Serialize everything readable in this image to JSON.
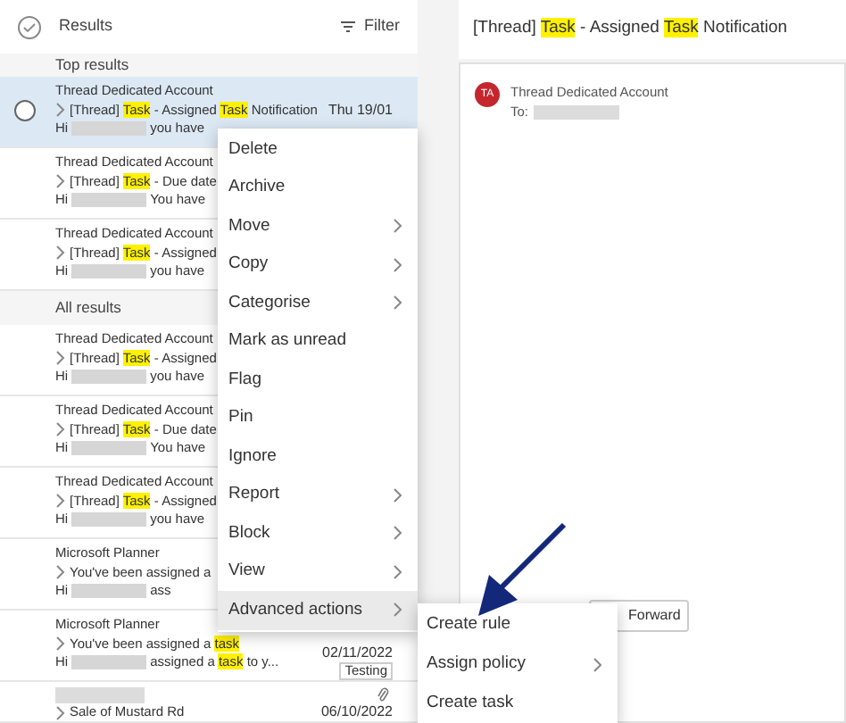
{
  "list_header": {
    "title": "Results",
    "filter": "Filter"
  },
  "sections": [
    {
      "label": "Top results",
      "rows": [
        {
          "sender": "Thread Dedicated Account",
          "subject": [
            {
              "text": "[Thread] ",
              "highlight": false
            },
            {
              "text": "Task",
              "highlight": true
            },
            {
              "text": " - Assigned ",
              "highlight": false
            },
            {
              "text": "Task",
              "highlight": true
            },
            {
              "text": " Notification",
              "highlight": false
            }
          ],
          "greeting": "Hi",
          "preview": [
            {
              "text": "you have",
              "highlight": false
            }
          ],
          "date": "Thu 19/01",
          "selected": true
        },
        {
          "sender": "Thread Dedicated Account",
          "subject": [
            {
              "text": "[Thread] ",
              "highlight": false
            },
            {
              "text": "Task",
              "highlight": true
            },
            {
              "text": " - Due date",
              "highlight": false
            }
          ],
          "greeting": "Hi",
          "preview": [
            {
              "text": "You have",
              "highlight": false
            }
          ],
          "selected": false
        },
        {
          "sender": "Thread Dedicated Account",
          "subject": [
            {
              "text": "[Thread] ",
              "highlight": false
            },
            {
              "text": "Task",
              "highlight": true
            },
            {
              "text": " - Assigned",
              "highlight": false
            }
          ],
          "greeting": "Hi",
          "preview": [
            {
              "text": "you have",
              "highlight": false
            }
          ],
          "selected": false
        }
      ]
    },
    {
      "label": "All results",
      "rows": [
        {
          "sender": "Thread Dedicated Account",
          "subject": [
            {
              "text": "[Thread] ",
              "highlight": false
            },
            {
              "text": "Task",
              "highlight": true
            },
            {
              "text": " - Assigned",
              "highlight": false
            }
          ],
          "greeting": "Hi",
          "preview": [
            {
              "text": "you have",
              "highlight": false
            }
          ],
          "selected": false
        },
        {
          "sender": "Thread Dedicated Account",
          "subject": [
            {
              "text": "[Thread] ",
              "highlight": false
            },
            {
              "text": "Task",
              "highlight": true
            },
            {
              "text": " - Due date",
              "highlight": false
            }
          ],
          "greeting": "Hi",
          "preview": [
            {
              "text": "You have",
              "highlight": false
            }
          ],
          "selected": false
        },
        {
          "sender": "Thread Dedicated Account",
          "subject": [
            {
              "text": "[Thread] ",
              "highlight": false
            },
            {
              "text": "Task",
              "highlight": true
            },
            {
              "text": " - Assigned",
              "highlight": false
            }
          ],
          "greeting": "Hi",
          "preview": [
            {
              "text": "you have",
              "highlight": false
            }
          ],
          "selected": false
        },
        {
          "sender": "Microsoft Planner",
          "subject": [
            {
              "text": "You've been assigned a",
              "highlight": false
            }
          ],
          "greeting": "Hi",
          "preview": [
            {
              "text": "ass",
              "highlight": false
            }
          ],
          "selected": false
        },
        {
          "sender": "Microsoft Planner",
          "subject": [
            {
              "text": "You've been assigned a ",
              "highlight": false
            },
            {
              "text": "task",
              "highlight": true
            }
          ],
          "greeting": "Hi",
          "preview": [
            {
              "text": "assigned a ",
              "highlight": false
            },
            {
              "text": "task",
              "highlight": true
            },
            {
              "text": " to y...",
              "highlight": false
            }
          ],
          "date": "02/11/2022",
          "tag": "Testing",
          "selected": false
        },
        {
          "sender_hidden": true,
          "subject": [
            {
              "text": "Sale of Mustard Rd",
              "highlight": false
            }
          ],
          "date": "06/10/2022",
          "attachment": true,
          "selected": false
        }
      ]
    }
  ],
  "reading_pane": {
    "title": [
      {
        "text": "[Thread] ",
        "highlight": false
      },
      {
        "text": "Task",
        "highlight": true
      },
      {
        "text": " - Assigned ",
        "highlight": false
      },
      {
        "text": "Task",
        "highlight": true
      },
      {
        "text": " Notification",
        "highlight": false
      }
    ],
    "avatar": "TA",
    "sender": "Thread Dedicated Account",
    "to_label": "To:",
    "buttons": [
      "Forward"
    ]
  },
  "context_menu": [
    {
      "label": "Delete",
      "submenu": false,
      "selected": false
    },
    {
      "label": "Archive",
      "submenu": false,
      "selected": false
    },
    {
      "label": "Move",
      "submenu": true,
      "selected": false
    },
    {
      "label": "Copy",
      "submenu": true,
      "selected": false
    },
    {
      "label": "Categorise",
      "submenu": true,
      "selected": false
    },
    {
      "label": "Mark as unread",
      "submenu": false,
      "selected": false
    },
    {
      "label": "Flag",
      "submenu": false,
      "selected": false
    },
    {
      "label": "Pin",
      "submenu": false,
      "selected": false
    },
    {
      "label": "Ignore",
      "submenu": false,
      "selected": false
    },
    {
      "label": "Report",
      "submenu": true,
      "selected": false
    },
    {
      "label": "Block",
      "submenu": true,
      "selected": false
    },
    {
      "label": "View",
      "submenu": true,
      "selected": false
    },
    {
      "label": "Advanced actions",
      "submenu": true,
      "selected": true
    }
  ],
  "submenu": [
    {
      "label": "Create rule",
      "submenu": false
    },
    {
      "label": "Assign policy",
      "submenu": true
    },
    {
      "label": "Create task",
      "submenu": false
    }
  ]
}
